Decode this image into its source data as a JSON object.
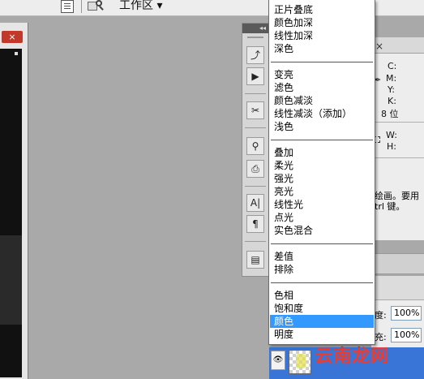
{
  "toolbar": {
    "workspace_label": "工作区 ▾"
  },
  "document": {
    "close_label": "×"
  },
  "dock": {
    "collapse_label": "◂◂",
    "tools": [
      {
        "name": "history-icon",
        "glyph": "⤴"
      },
      {
        "name": "actions-play-icon",
        "glyph": "▶"
      },
      {
        "name": "tools-icon",
        "glyph": "✂"
      },
      {
        "name": "brushes-icon",
        "glyph": "⚲"
      },
      {
        "name": "clone-source-icon",
        "glyph": "⎙"
      },
      {
        "name": "character-icon",
        "glyph": "A|"
      },
      {
        "name": "paragraph-icon",
        "glyph": "¶"
      },
      {
        "name": "notes-icon",
        "glyph": "▤"
      }
    ]
  },
  "info_panel": {
    "close_label": "×",
    "c": "C:",
    "m": "M:",
    "y": "Y:",
    "k": "K:",
    "bits": "8 位",
    "w": "W:",
    "h": "H:",
    "hint_line1": "绘画。要用",
    "hint_line2": "trl 键。"
  },
  "layers_panel": {
    "opacity_label": "度:",
    "opacity_value": "100%",
    "fill_label": "充:",
    "fill_value": "100%"
  },
  "watermark": "云南龙网",
  "blend_menu": {
    "groups": [
      [
        "正片叠底",
        "颜色加深",
        "线性加深",
        "深色"
      ],
      [
        "变亮",
        "滤色",
        "颜色减淡",
        "线性减淡（添加）",
        "浅色"
      ],
      [
        "叠加",
        "柔光",
        "强光",
        "亮光",
        "线性光",
        "点光",
        "实色混合"
      ],
      [
        "差值",
        "排除"
      ],
      [
        "色相",
        "饱和度",
        "颜色",
        "明度"
      ]
    ],
    "selected": "颜色"
  }
}
